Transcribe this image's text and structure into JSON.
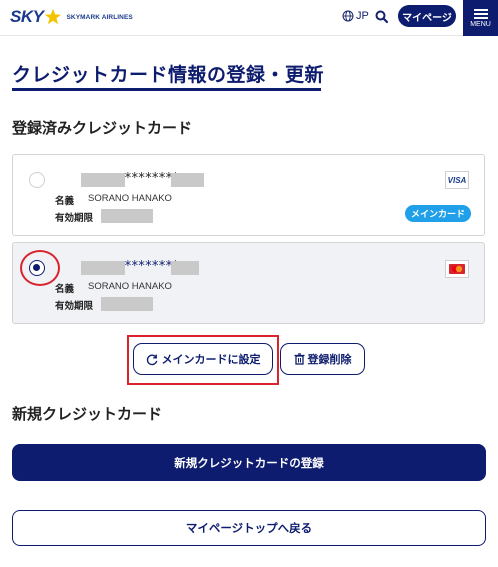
{
  "header": {
    "logo_primary": "SKY",
    "logo_secondary": "SKYMARK AIRLINES",
    "language": "JP",
    "mypage_label": "マイページ",
    "menu_label": "MENU",
    "icons": [
      "globe-icon",
      "search-icon",
      "hamburger-menu-icon",
      "star-logo-icon"
    ]
  },
  "page": {
    "title": "クレジットカード情報の登録・更新"
  },
  "registered": {
    "heading": "登録済みクレジットカード",
    "cards": [
      {
        "masked_number": "********",
        "name_label": "名義",
        "name_value": "SORANO HANAKO",
        "expiry_label": "有効期限",
        "brand": "VISA",
        "badge": "メインカード",
        "selected": false
      },
      {
        "masked_number": "********",
        "name_label": "名義",
        "name_value": "SORANO HANAKO",
        "expiry_label": "有効期限",
        "brand": "mastercard",
        "badge": "",
        "selected": true
      }
    ],
    "set_main_label": "メインカードに設定",
    "delete_label": "登録削除"
  },
  "new_card": {
    "heading": "新規クレジットカード",
    "register_label": "新規クレジットカードの登録"
  },
  "footer": {
    "back_label": "マイページトップへ戻る"
  },
  "colors": {
    "navy": "#0d1c6e",
    "badge_blue": "#1fa0e8",
    "highlight_red": "#d9232d"
  }
}
